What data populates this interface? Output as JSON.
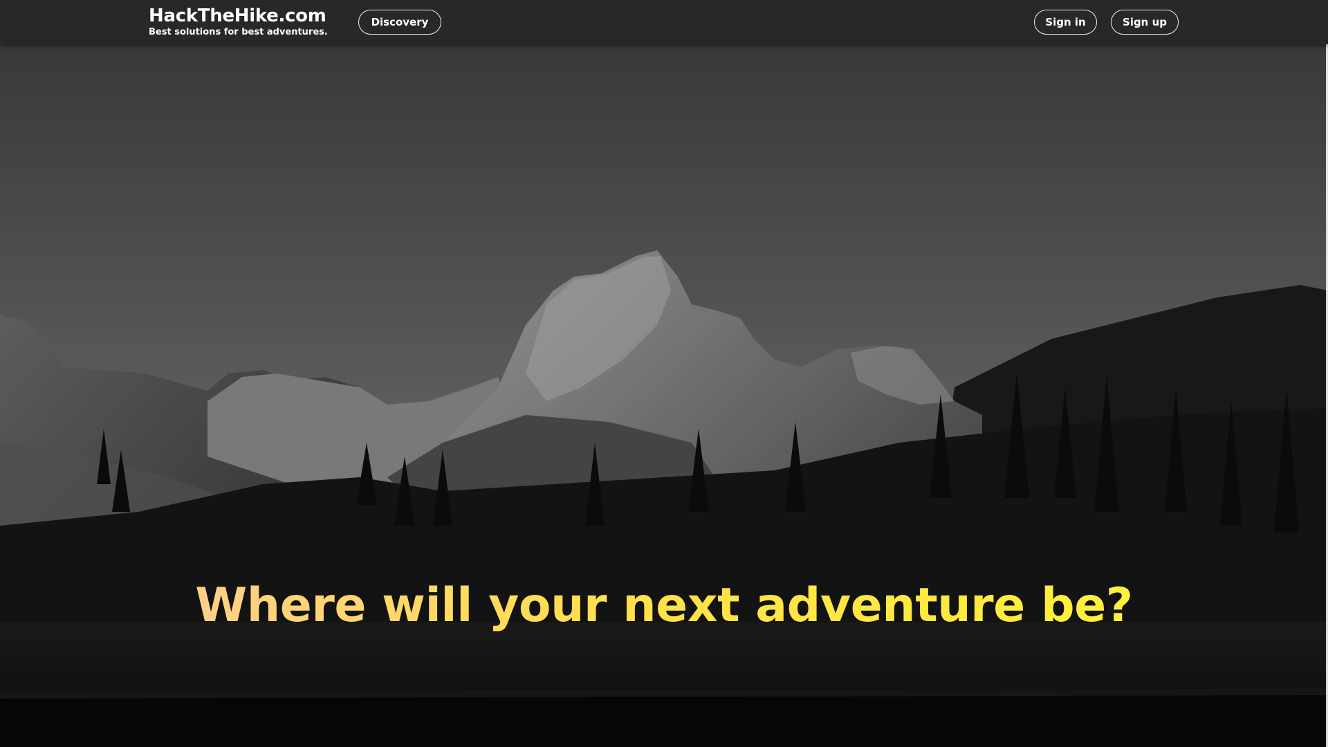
{
  "navbar": {
    "brand_title": "HackTheHike.com",
    "brand_tagline": "Best solutions for best adventures.",
    "discovery_label": "Discovery",
    "signin_label": "Sign in",
    "signup_label": "Sign up"
  },
  "hero": {
    "headline": "Where will your next adventure be?"
  },
  "colors": {
    "navbar_bg": "#282828",
    "headline_gradient_start": "#ffcf86",
    "headline_gradient_end": "#fff03a",
    "button_border": "#f2f2f2"
  }
}
